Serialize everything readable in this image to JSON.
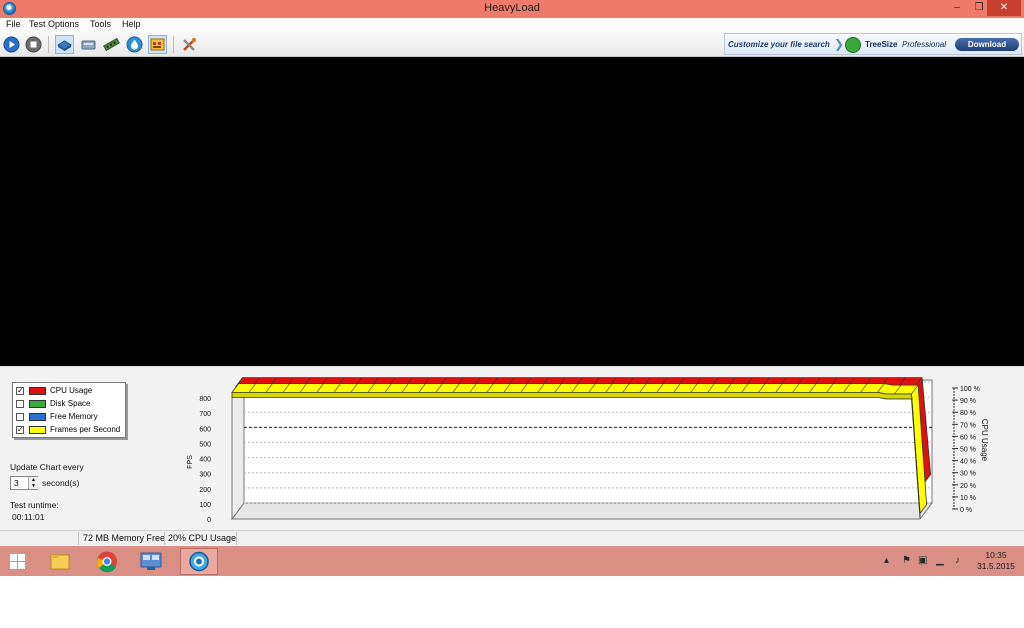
{
  "window": {
    "title": "HeavyLoad",
    "min_glyph": "–",
    "max_glyph": "❐",
    "close_glyph": "✕"
  },
  "menu": [
    {
      "label": "File"
    },
    {
      "label": "Test Options"
    },
    {
      "label": "Tools"
    },
    {
      "label": "Help"
    }
  ],
  "toolbar": {
    "buttons": [
      {
        "icon": "play-icon"
      },
      {
        "icon": "stop-icon"
      },
      {
        "icon": "cpu-chip-icon",
        "pressed": true
      },
      {
        "icon": "disk-drive-icon"
      },
      {
        "icon": "memory-module-icon"
      },
      {
        "icon": "water-drop-icon"
      },
      {
        "icon": "frames-grid-icon",
        "pressed": true
      },
      {
        "icon": "tools-icon"
      }
    ]
  },
  "ad": {
    "tagline": "Customize your file search",
    "product": "TreeSize",
    "product_edition": "Professional",
    "button": "Download"
  },
  "legend": [
    {
      "label": "CPU Usage",
      "checked": true,
      "color": "#e01010"
    },
    {
      "label": "Disk Space",
      "checked": false,
      "color": "#3aa83a"
    },
    {
      "label": "Free Memory",
      "checked": false,
      "color": "#2a6fd0"
    },
    {
      "label": "Frames per Second",
      "checked": true,
      "color": "#ffff00"
    }
  ],
  "update": {
    "label": "Update Chart every",
    "value": "3",
    "unit": "second(s)"
  },
  "runtime": {
    "label": "Test runtime:",
    "value": "00:11:01"
  },
  "chart_data": {
    "type": "area",
    "y_left_label": "FPS",
    "y_right_label": "CPU Usage",
    "y_left_ticks": [
      "0",
      "100",
      "200",
      "300",
      "400",
      "500",
      "600",
      "700",
      "800"
    ],
    "y_right_ticks": [
      "0 %",
      "10 %",
      "20 %",
      "30 %",
      "40 %",
      "50 %",
      "60 %",
      "70 %",
      "80 %",
      "90 %",
      "100 %"
    ],
    "ylim_left": [
      0,
      800
    ],
    "ylim_right": [
      0,
      100
    ],
    "series": [
      {
        "name": "CPU Usage",
        "color": "#e01010",
        "values": [
          100,
          100,
          100,
          100,
          100,
          100,
          100,
          100,
          100,
          100,
          100,
          100,
          100,
          100,
          100,
          100,
          100,
          100,
          100,
          100,
          100,
          100,
          100,
          100,
          100,
          100,
          100,
          100,
          100,
          100,
          100,
          100,
          100,
          100,
          100,
          100,
          100,
          100,
          100,
          100,
          100,
          100,
          100,
          100,
          100,
          100,
          100,
          100,
          100,
          100,
          100,
          100,
          100,
          100,
          100,
          100,
          100,
          100,
          100,
          100,
          100,
          100,
          100,
          100,
          100,
          100,
          100,
          100,
          100,
          100,
          100,
          100,
          100,
          100,
          100,
          100,
          100,
          100,
          100,
          100,
          100,
          20
        ]
      },
      {
        "name": "Frames per Second",
        "color": "#ffff00",
        "values": [
          800,
          800,
          800,
          800,
          800,
          800,
          800,
          800,
          800,
          800,
          800,
          800,
          800,
          800,
          800,
          800,
          800,
          800,
          800,
          800,
          800,
          800,
          800,
          800,
          800,
          800,
          800,
          800,
          800,
          800,
          800,
          800,
          800,
          800,
          800,
          800,
          800,
          800,
          800,
          800,
          800,
          800,
          800,
          800,
          800,
          800,
          800,
          800,
          800,
          800,
          800,
          800,
          800,
          800,
          800,
          800,
          800,
          800,
          800,
          800,
          800,
          800,
          800,
          800,
          800,
          800,
          800,
          800,
          800,
          800,
          800,
          800,
          800,
          800,
          800,
          800,
          800,
          790,
          790,
          790,
          790,
          0
        ]
      }
    ],
    "grid": true,
    "dashed_gridline_at": 500
  },
  "status": {
    "memory": "72 MB Memory Free",
    "cpu": "20% CPU Usage"
  },
  "taskbar": {
    "items": [
      {
        "icon": "windows-start-icon"
      },
      {
        "icon": "file-explorer-icon"
      },
      {
        "icon": "chrome-icon"
      },
      {
        "icon": "control-panel-icon"
      },
      {
        "icon": "heavyload-icon",
        "active": true
      }
    ],
    "tray": [
      {
        "icon": "show-hidden-icons-chevron",
        "glyph": "▴"
      },
      {
        "icon": "action-center-flag-icon",
        "glyph": "⚑"
      },
      {
        "icon": "network-adapter-icon",
        "glyph": "▣"
      },
      {
        "icon": "wifi-signal-icon",
        "glyph": "▁"
      },
      {
        "icon": "speaker-volume-icon",
        "glyph": "♪"
      }
    ],
    "time": "10:35",
    "date": "31.5.2015"
  }
}
